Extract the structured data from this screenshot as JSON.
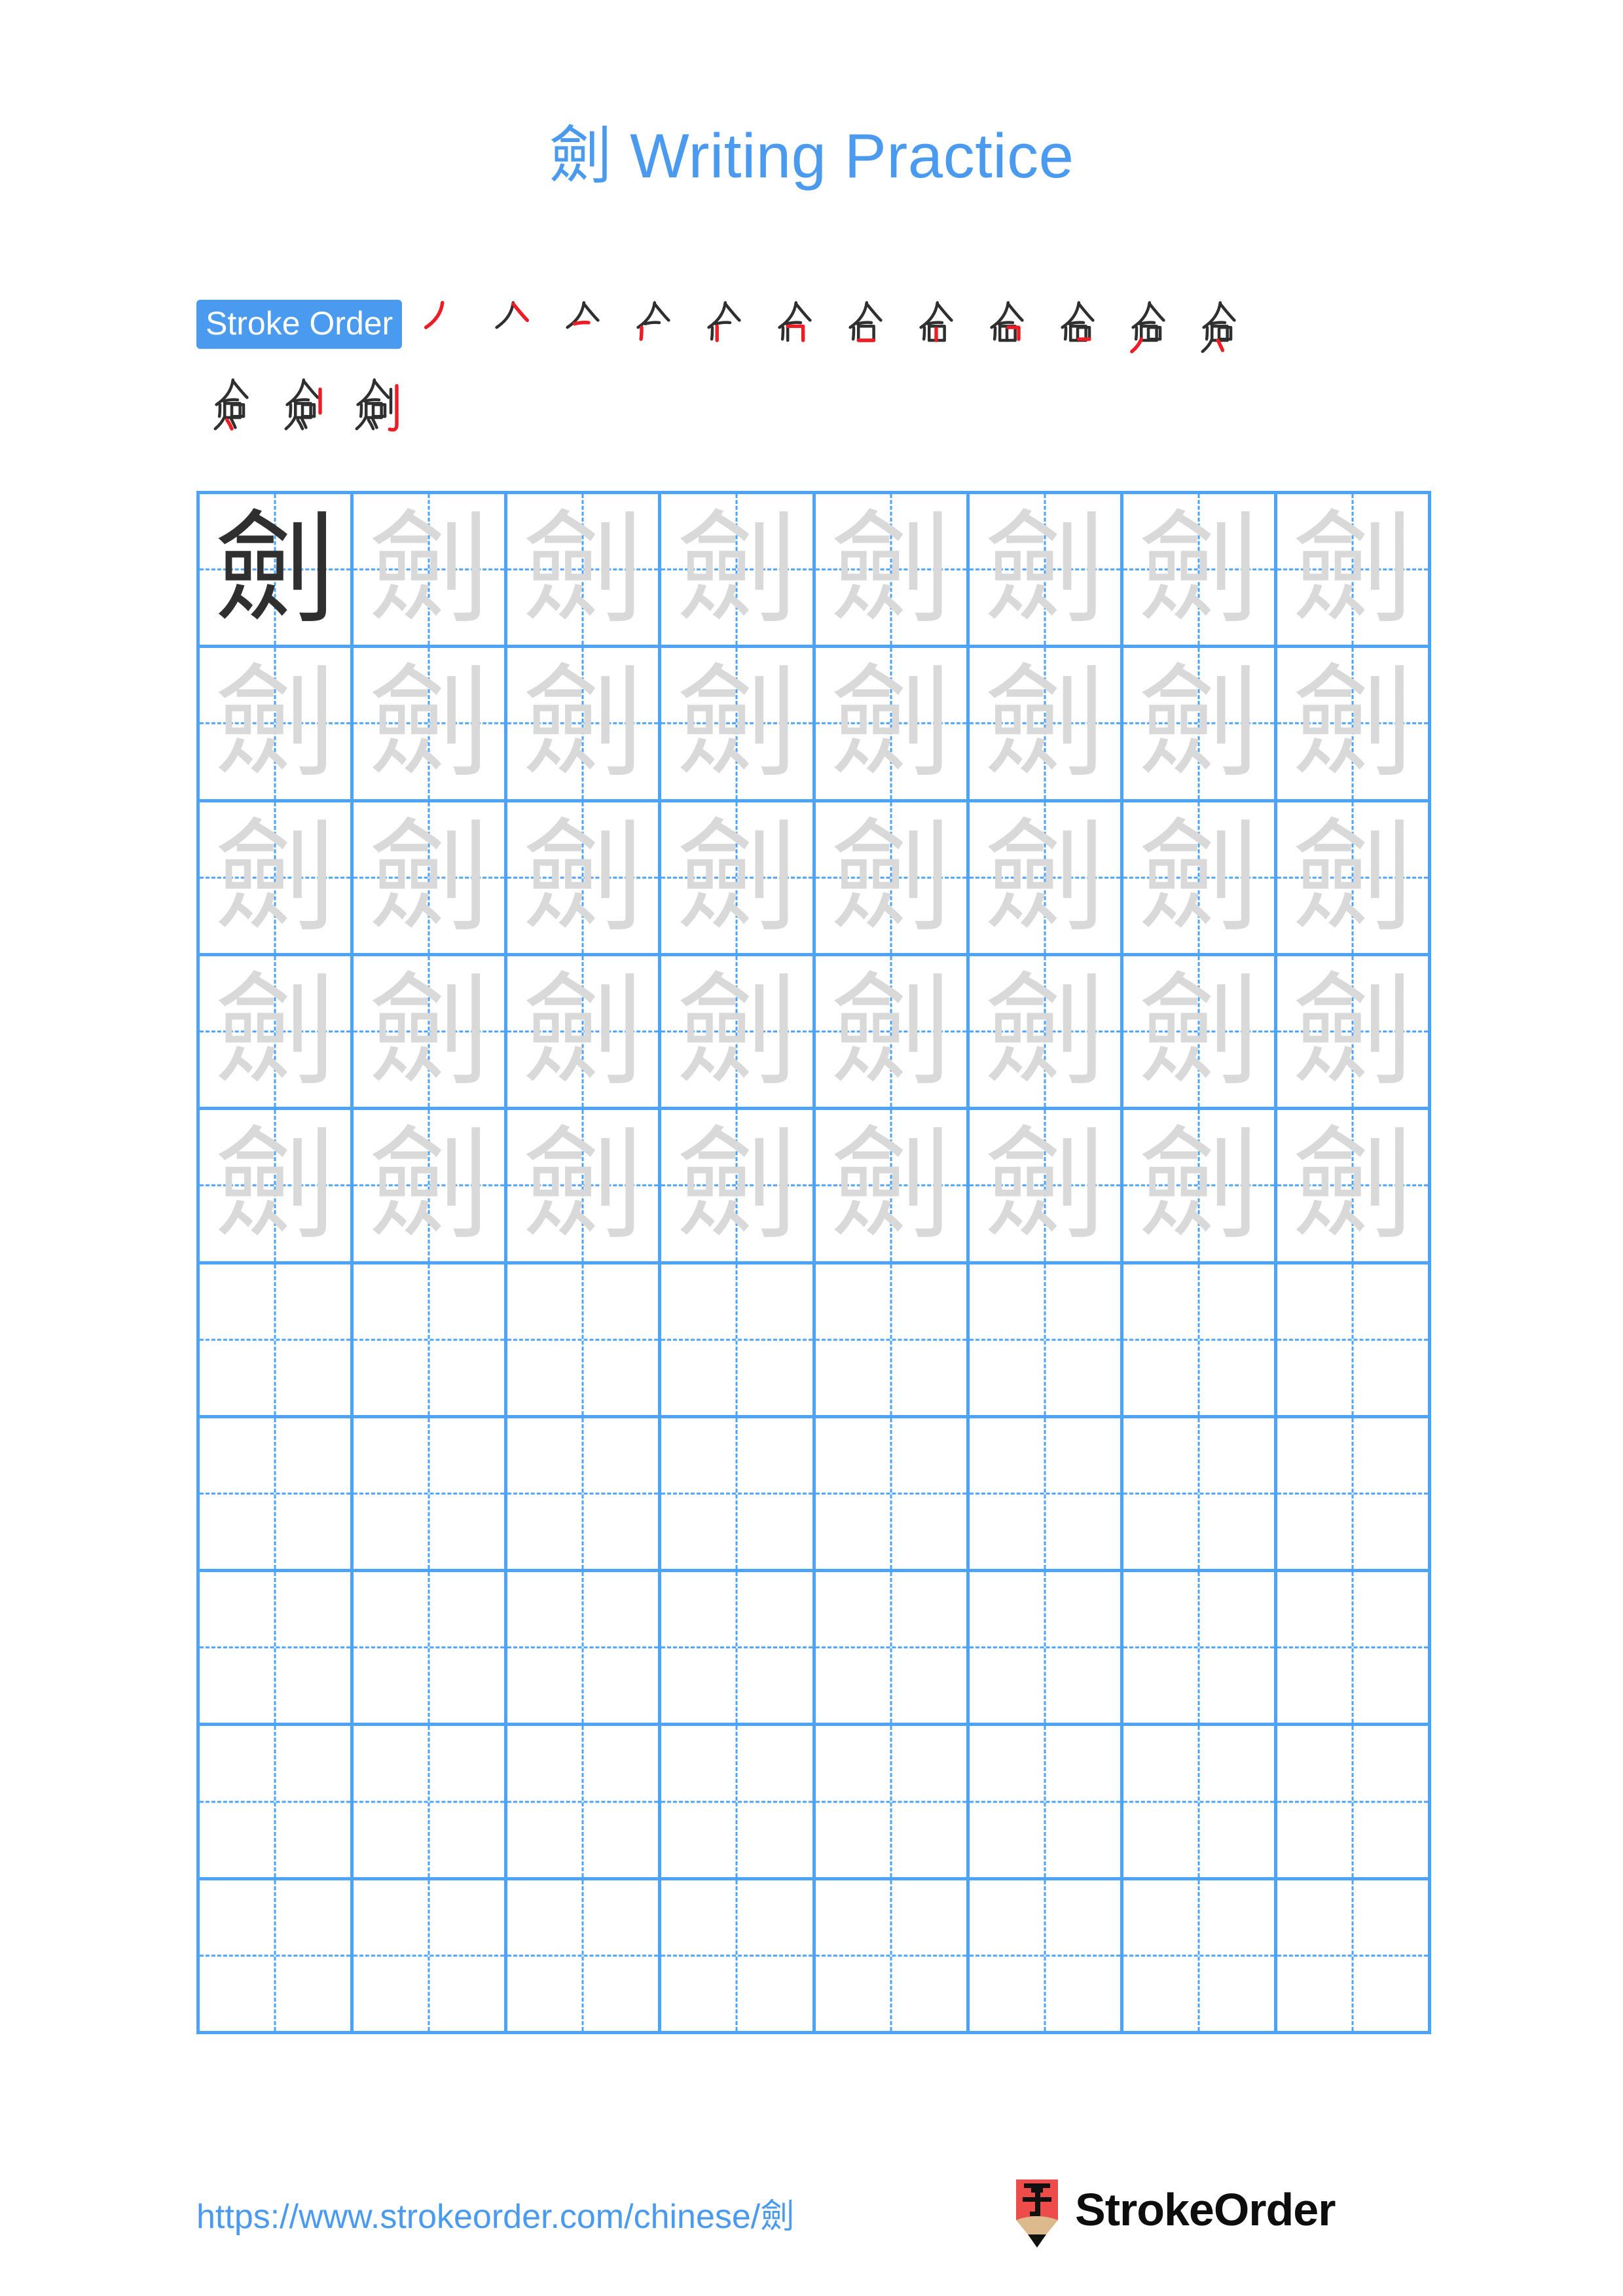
{
  "character": "劍",
  "header": {
    "title": "劍 Writing Practice"
  },
  "stroke_order": {
    "label": "Stroke Order",
    "total_strokes": 15,
    "steps": [
      {
        "index": 1,
        "partial": "丿"
      },
      {
        "index": 2,
        "partial": "𠆢"
      },
      {
        "index": 3,
        "partial": "亽"
      },
      {
        "index": 4,
        "partial": "亽"
      },
      {
        "index": 5,
        "partial": "合"
      },
      {
        "index": 6,
        "partial": "合"
      },
      {
        "index": 7,
        "partial": "佥"
      },
      {
        "index": 8,
        "partial": "侖"
      },
      {
        "index": 9,
        "partial": "侖"
      },
      {
        "index": 10,
        "partial": "兪"
      },
      {
        "index": 11,
        "partial": "僉"
      },
      {
        "index": 12,
        "partial": "僉"
      },
      {
        "index": 13,
        "partial": "僉"
      },
      {
        "index": 14,
        "partial": "劍"
      },
      {
        "index": 15,
        "partial": "劍"
      }
    ]
  },
  "practice_grid": {
    "columns": 8,
    "rows": 10,
    "traced_rows": 5,
    "model_cell": {
      "row": 1,
      "column": 1
    },
    "trace_character": "劍",
    "model_character": "劍"
  },
  "footer": {
    "url": "https://www.strokeorder.com/chinese/劍",
    "brand_name": "StrokeOrder",
    "brand_mark_character": "字"
  },
  "colors": {
    "accent_blue": "#4a9bf0",
    "grid_blue": "#4da3f7",
    "trace_gray": "#d9d9d9",
    "model_black": "#2f2f2f",
    "stroke_new_red": "#ee1c25",
    "brand_red": "#ee4b4b",
    "brand_wood": "#ddba8e"
  }
}
